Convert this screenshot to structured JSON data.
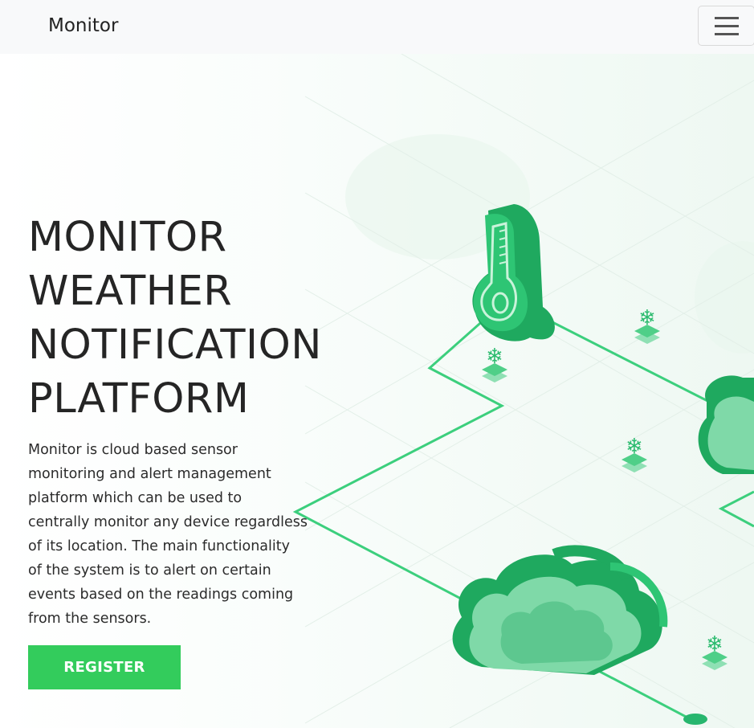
{
  "navbar": {
    "brand": "Monitor",
    "menu_icon": "hamburger-menu-icon"
  },
  "hero": {
    "title_lines": [
      "MONITOR",
      "WEATHER",
      "NOTIFICATION",
      "PLATFORM"
    ],
    "description_lines": [
      "Monitor is cloud based sensor",
      "monitoring and alert management",
      "platform which can be used to",
      "centrally monitor any device regardless",
      "of its location. The main functionality",
      "of the system is to alert on certain",
      "events based on the readings coming",
      "from the sensors."
    ],
    "register_label": "REGISTER"
  },
  "illustration": {
    "icons": [
      "thermometer-icon",
      "cloud-icon",
      "snowflake-icon"
    ]
  },
  "colors": {
    "accent": "#33cc5c",
    "illustration_green": "#1fb56a",
    "navbar_bg": "#f8f9fa"
  }
}
